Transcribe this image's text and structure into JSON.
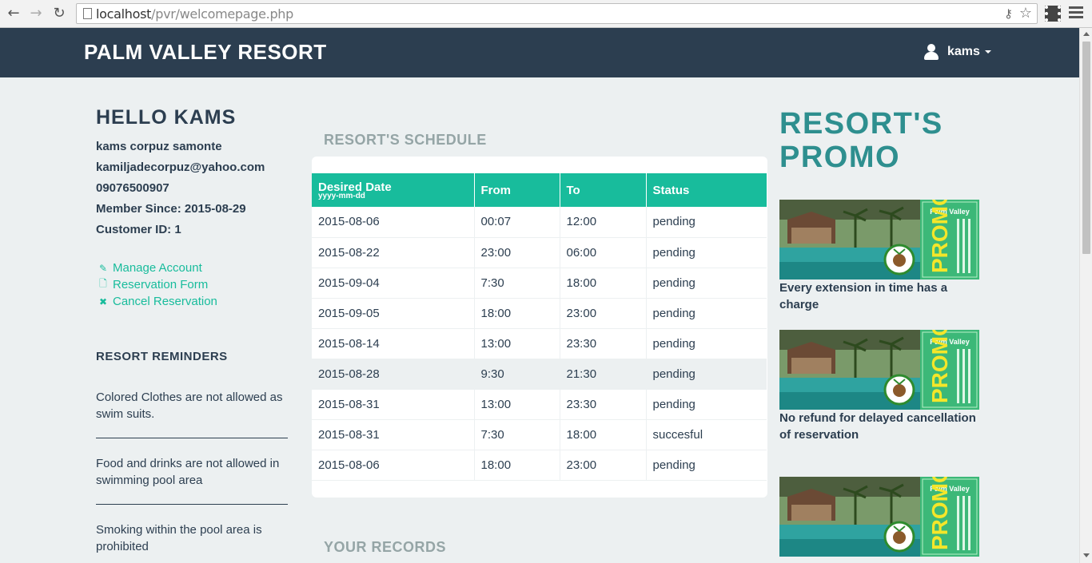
{
  "browser": {
    "url_host": "localhost",
    "url_path": "/pvr/welcomepage.php"
  },
  "navbar": {
    "brand": "PALM VALLEY RESORT",
    "user": "kams"
  },
  "profile": {
    "greeting": "HELLO KAMS",
    "name": "kams corpuz samonte",
    "email": "kamiljadecorpuz@yahoo.com",
    "phone": "09076500907",
    "member_since": "Member Since: 2015-08-29",
    "customer_id": "Customer ID: 1"
  },
  "links": {
    "manage": "Manage Account",
    "reservation": "Reservation Form",
    "cancel": "Cancel Reservation"
  },
  "reminders": {
    "title": "RESORT REMINDERS",
    "items": [
      "Colored Clothes are not allowed as swim suits.",
      "Food and drinks are not allowed in swimming pool area",
      "Smoking within the pool area is prohibited"
    ]
  },
  "schedule": {
    "title": "RESORT'S SCHEDULE",
    "headers": {
      "date": "Desired Date",
      "date_hint": "yyyy-mm-dd",
      "from": "From",
      "to": "To",
      "status": "Status"
    },
    "rows": [
      [
        "2015-08-06",
        "00:07",
        "12:00",
        "pending"
      ],
      [
        "2015-08-22",
        "23:00",
        "06:00",
        "pending"
      ],
      [
        "2015-09-04",
        "7:30",
        "18:00",
        "pending"
      ],
      [
        "2015-09-05",
        "18:00",
        "23:00",
        "pending"
      ],
      [
        "2015-08-14",
        "13:00",
        "23:30",
        "pending"
      ],
      [
        "2015-08-28",
        "9:30",
        "21:30",
        "pending"
      ],
      [
        "2015-08-31",
        "13:00",
        "23:30",
        "pending"
      ],
      [
        "2015-08-31",
        "7:30",
        "18:00",
        "succesful"
      ],
      [
        "2015-08-06",
        "18:00",
        "23:00",
        "pending"
      ]
    ],
    "highlighted_row_index": 5
  },
  "records": {
    "title": "YOUR RECORDS"
  },
  "promo": {
    "title_line1": "RESORT'S",
    "title_line2": "PROMO",
    "banner_brand": "Palm Valley",
    "banner_word": "PROMO",
    "captions": [
      "Every extension in time has a charge",
      "No refund for delayed cancellation of reservation"
    ]
  },
  "colors": {
    "navbar": "#2c3e50",
    "accent": "#18bc9c",
    "promo_title": "#2e8f8f",
    "background": "#ecf0f1"
  }
}
